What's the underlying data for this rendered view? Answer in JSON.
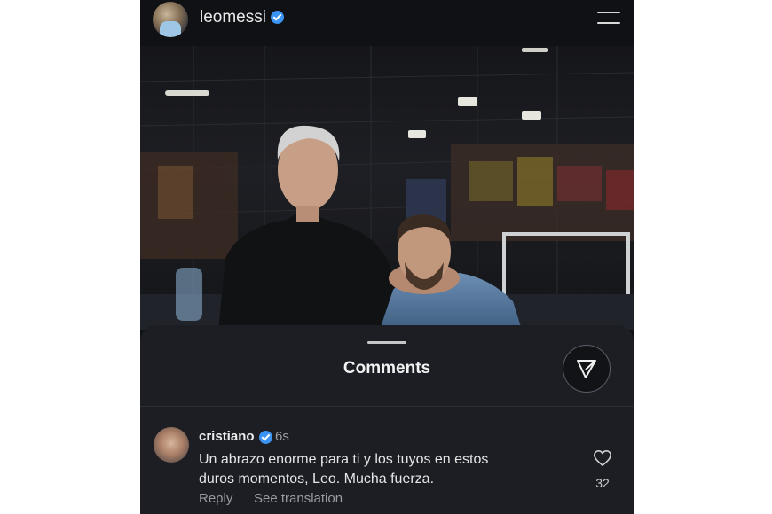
{
  "header": {
    "username": "leomessi",
    "verified": true,
    "avatar_icon": "profile-avatar",
    "menu_icon": "hamburger-menu-icon"
  },
  "post": {
    "image_alt_icon": "post-photo"
  },
  "comments_sheet": {
    "title": "Comments",
    "share_icon": "send-icon"
  },
  "comment": {
    "username": "cristiano",
    "verified": true,
    "time": "6s",
    "text_line_1": "Un abrazo enorme para ti y los tuyos en estos",
    "text_line_2": "duros momentos, Leo. Mucha fuerza.",
    "reply_label": "Reply",
    "translate_label": "See translation",
    "like_count": "32",
    "like_icon": "heart-icon"
  },
  "colors": {
    "background": "#0f1115",
    "sheet": "#1c1e24",
    "verified_badge": "#3b94f2",
    "secondary_text": "#9a9ca3"
  }
}
